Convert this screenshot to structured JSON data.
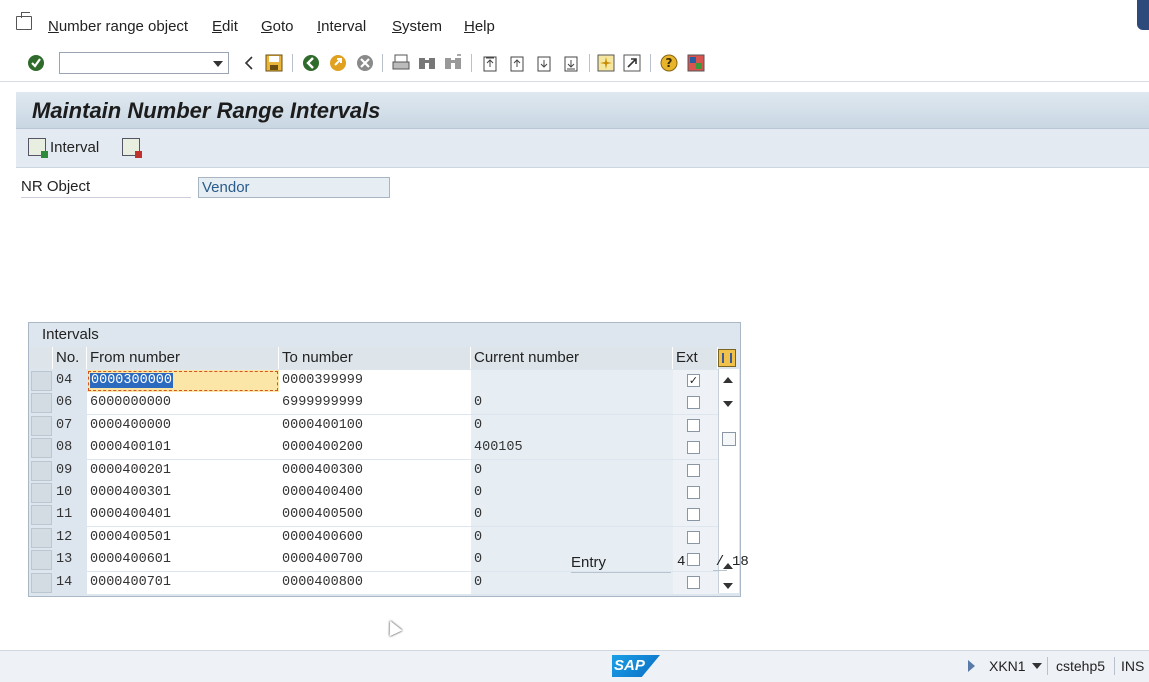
{
  "menu": {
    "items": [
      "Number range object",
      "Edit",
      "Goto",
      "Interval",
      "System",
      "Help"
    ]
  },
  "toolbar": {
    "command_field_value": "",
    "icons": [
      "enter-icon",
      "back-nav-icon",
      "save-icon",
      "back-icon",
      "exit-icon",
      "cancel-icon",
      "print-icon",
      "find-icon",
      "find-next-icon",
      "first-page-icon",
      "previous-page-icon",
      "next-page-icon",
      "last-page-icon",
      "create-session-icon",
      "shortcut-icon",
      "help-icon",
      "customize-layout-icon"
    ]
  },
  "screen": {
    "title": "Maintain Number Range Intervals",
    "interval_button": "Interval"
  },
  "nr_object": {
    "label": "NR Object",
    "value": "Vendor"
  },
  "intervals": {
    "title": "Intervals",
    "columns": [
      "No.",
      "From number",
      "To number",
      "Current number",
      "Ext"
    ],
    "rows": [
      {
        "no": "04",
        "from": "0000300000",
        "to": "0000399999",
        "current": "",
        "ext": true
      },
      {
        "no": "06",
        "from": "6000000000",
        "to": "6999999999",
        "current": "0",
        "ext": false
      },
      {
        "no": "07",
        "from": "0000400000",
        "to": "0000400100",
        "current": "0",
        "ext": false
      },
      {
        "no": "08",
        "from": "0000400101",
        "to": "0000400200",
        "current": "400105",
        "ext": false
      },
      {
        "no": "09",
        "from": "0000400201",
        "to": "0000400300",
        "current": "0",
        "ext": false
      },
      {
        "no": "10",
        "from": "0000400301",
        "to": "0000400400",
        "current": "0",
        "ext": false
      },
      {
        "no": "11",
        "from": "0000400401",
        "to": "0000400500",
        "current": "0",
        "ext": false
      },
      {
        "no": "12",
        "from": "0000400501",
        "to": "0000400600",
        "current": "0",
        "ext": false
      },
      {
        "no": "13",
        "from": "0000400601",
        "to": "0000400700",
        "current": "0",
        "ext": false
      },
      {
        "no": "14",
        "from": "0000400701",
        "to": "0000400800",
        "current": "0",
        "ext": false
      }
    ]
  },
  "entry": {
    "label": "Entry",
    "current": "4",
    "separator": "/",
    "total": "18"
  },
  "status": {
    "logo": "SAP",
    "transaction": "XKN1",
    "server": "cstehp5",
    "mode": "INS"
  }
}
